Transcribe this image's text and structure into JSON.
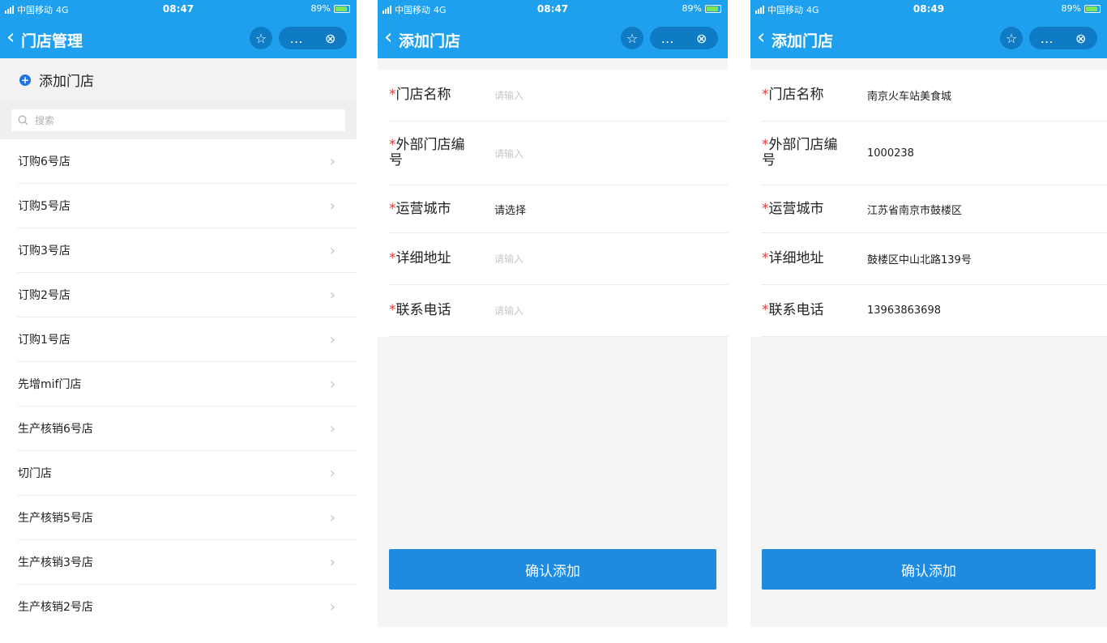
{
  "status": {
    "carrier": "中国移动",
    "network": "4G",
    "battery": "89%",
    "times": [
      "08:47",
      "08:47",
      "08:49"
    ]
  },
  "panel1": {
    "title": "门店管理",
    "add_label": "添加门店",
    "search_placeholder": "搜索",
    "stores": [
      "订购6号店",
      "订购5号店",
      "订购3号店",
      "订购2号店",
      "订购1号店",
      "先增mif门店",
      "生产核销6号店",
      "切门店",
      "生产核销5号店",
      "生产核销3号店",
      "生产核销2号店"
    ]
  },
  "panel2": {
    "title": "添加门店",
    "fields": {
      "name_label": "门店名称",
      "name_placeholder": "请输入",
      "ext_label_line1": "外部门店编",
      "ext_label_line2": "号",
      "ext_placeholder": "请输入",
      "city_label": "运营城市",
      "city_value": "请选择",
      "address_label": "详细地址",
      "address_placeholder": "请输入",
      "phone_label": "联系电话",
      "phone_placeholder": "请输入"
    },
    "confirm_label": "确认添加"
  },
  "panel3": {
    "title": "添加门店",
    "fields": {
      "name_label": "门店名称",
      "name_value": "南京火车站美食城",
      "ext_label_line1": "外部门店编",
      "ext_label_line2": "号",
      "ext_value": "1000238",
      "city_label": "运营城市",
      "city_value": "江苏省南京市鼓楼区",
      "address_label": "详细地址",
      "address_value": "鼓楼区中山北路139号",
      "phone_label": "联系电话",
      "phone_value": "13963863698"
    },
    "confirm_label": "确认添加"
  },
  "icons": {
    "back": "chevron-left-icon",
    "star": "star-icon",
    "more": "more-icon",
    "close": "close-circle-icon",
    "search": "search-icon",
    "chevron": "chevron-right-icon"
  },
  "colors": {
    "header": "#1ea0ef",
    "button": "#1e8ae0",
    "required": "#e53935"
  }
}
